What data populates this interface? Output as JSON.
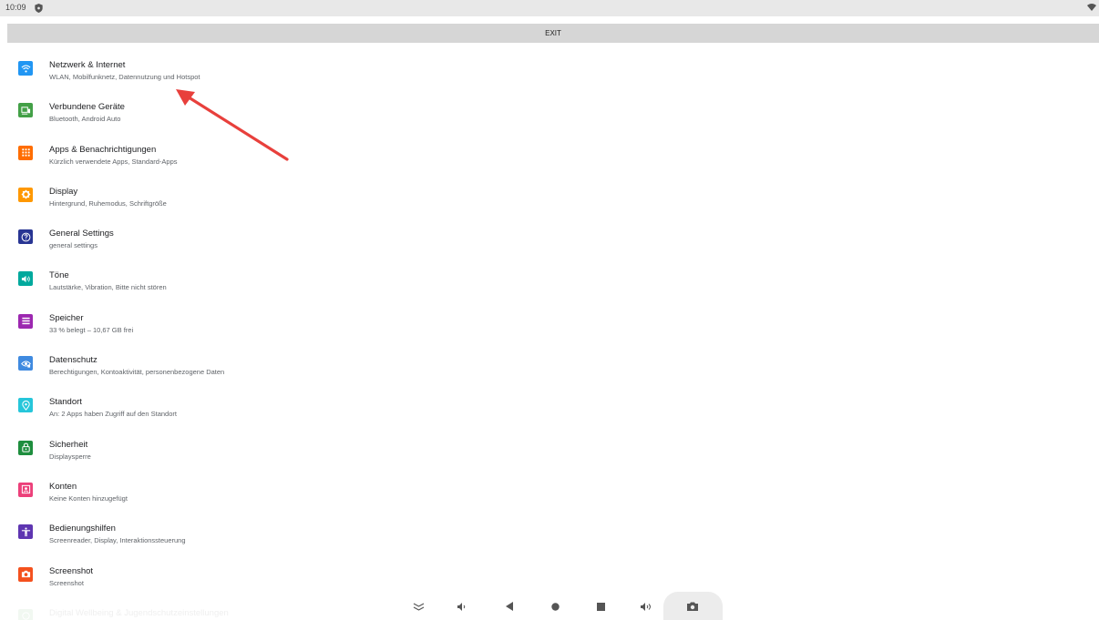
{
  "status_bar": {
    "time": "10:09"
  },
  "exit_bar": {
    "label": "EXIT"
  },
  "settings": [
    {
      "id": "network",
      "title": "Netzwerk & Internet",
      "subtitle": "WLAN, Mobilfunknetz, Datennutzung und Hotspot",
      "icon": "wifi-icon",
      "color": "#2196f3"
    },
    {
      "id": "connected-devices",
      "title": "Verbundene Geräte",
      "subtitle": "Bluetooth, Android Auto",
      "icon": "devices-icon",
      "color": "#43a047"
    },
    {
      "id": "apps",
      "title": "Apps & Benachrichtigungen",
      "subtitle": "Kürzlich verwendete Apps, Standard-Apps",
      "icon": "apps-icon",
      "color": "#ff6d00"
    },
    {
      "id": "display",
      "title": "Display",
      "subtitle": "Hintergrund, Ruhemodus, Schriftgröße",
      "icon": "brightness-icon",
      "color": "#ff9800"
    },
    {
      "id": "general",
      "title": "General Settings",
      "subtitle": "general settings",
      "icon": "help-icon",
      "color": "#283593"
    },
    {
      "id": "sound",
      "title": "Töne",
      "subtitle": "Lautstärke, Vibration, Bitte nicht stören",
      "icon": "volume-icon",
      "color": "#00a99d"
    },
    {
      "id": "storage",
      "title": "Speicher",
      "subtitle": "33 % belegt – 10,67 GB frei",
      "icon": "storage-icon",
      "color": "#9c27b0"
    },
    {
      "id": "privacy",
      "title": "Datenschutz",
      "subtitle": "Berechtigungen, Kontoaktivität, personenbezogene Daten",
      "icon": "privacy-icon",
      "color": "#3f8ae0"
    },
    {
      "id": "location",
      "title": "Standort",
      "subtitle": "An: 2 Apps haben Zugriff auf den Standort",
      "icon": "location-icon",
      "color": "#26c6da"
    },
    {
      "id": "security",
      "title": "Sicherheit",
      "subtitle": "Displaysperre",
      "icon": "lock-icon",
      "color": "#1e8e3e"
    },
    {
      "id": "accounts",
      "title": "Konten",
      "subtitle": "Keine Konten hinzugefügt",
      "icon": "account-icon",
      "color": "#ec407a"
    },
    {
      "id": "accessibility",
      "title": "Bedienungshilfen",
      "subtitle": "Screenreader, Display, Interaktionssteuerung",
      "icon": "accessibility-icon",
      "color": "#5e35b1"
    },
    {
      "id": "screenshot",
      "title": "Screenshot",
      "subtitle": "Screenshot",
      "icon": "camera-icon",
      "color": "#f4511e"
    },
    {
      "id": "wellbeing",
      "title": "Digital Wellbeing & Jugendschutzeinstellungen",
      "subtitle": "",
      "icon": "wellbeing-icon",
      "color": "#43a047"
    }
  ],
  "nav_bar": {
    "buttons": [
      "collapse-icon",
      "volume-down-icon",
      "back-icon",
      "home-icon",
      "recents-icon",
      "volume-up-icon",
      "screenshot-icon"
    ]
  },
  "annotation": {
    "arrow_color": "#e8403c"
  }
}
